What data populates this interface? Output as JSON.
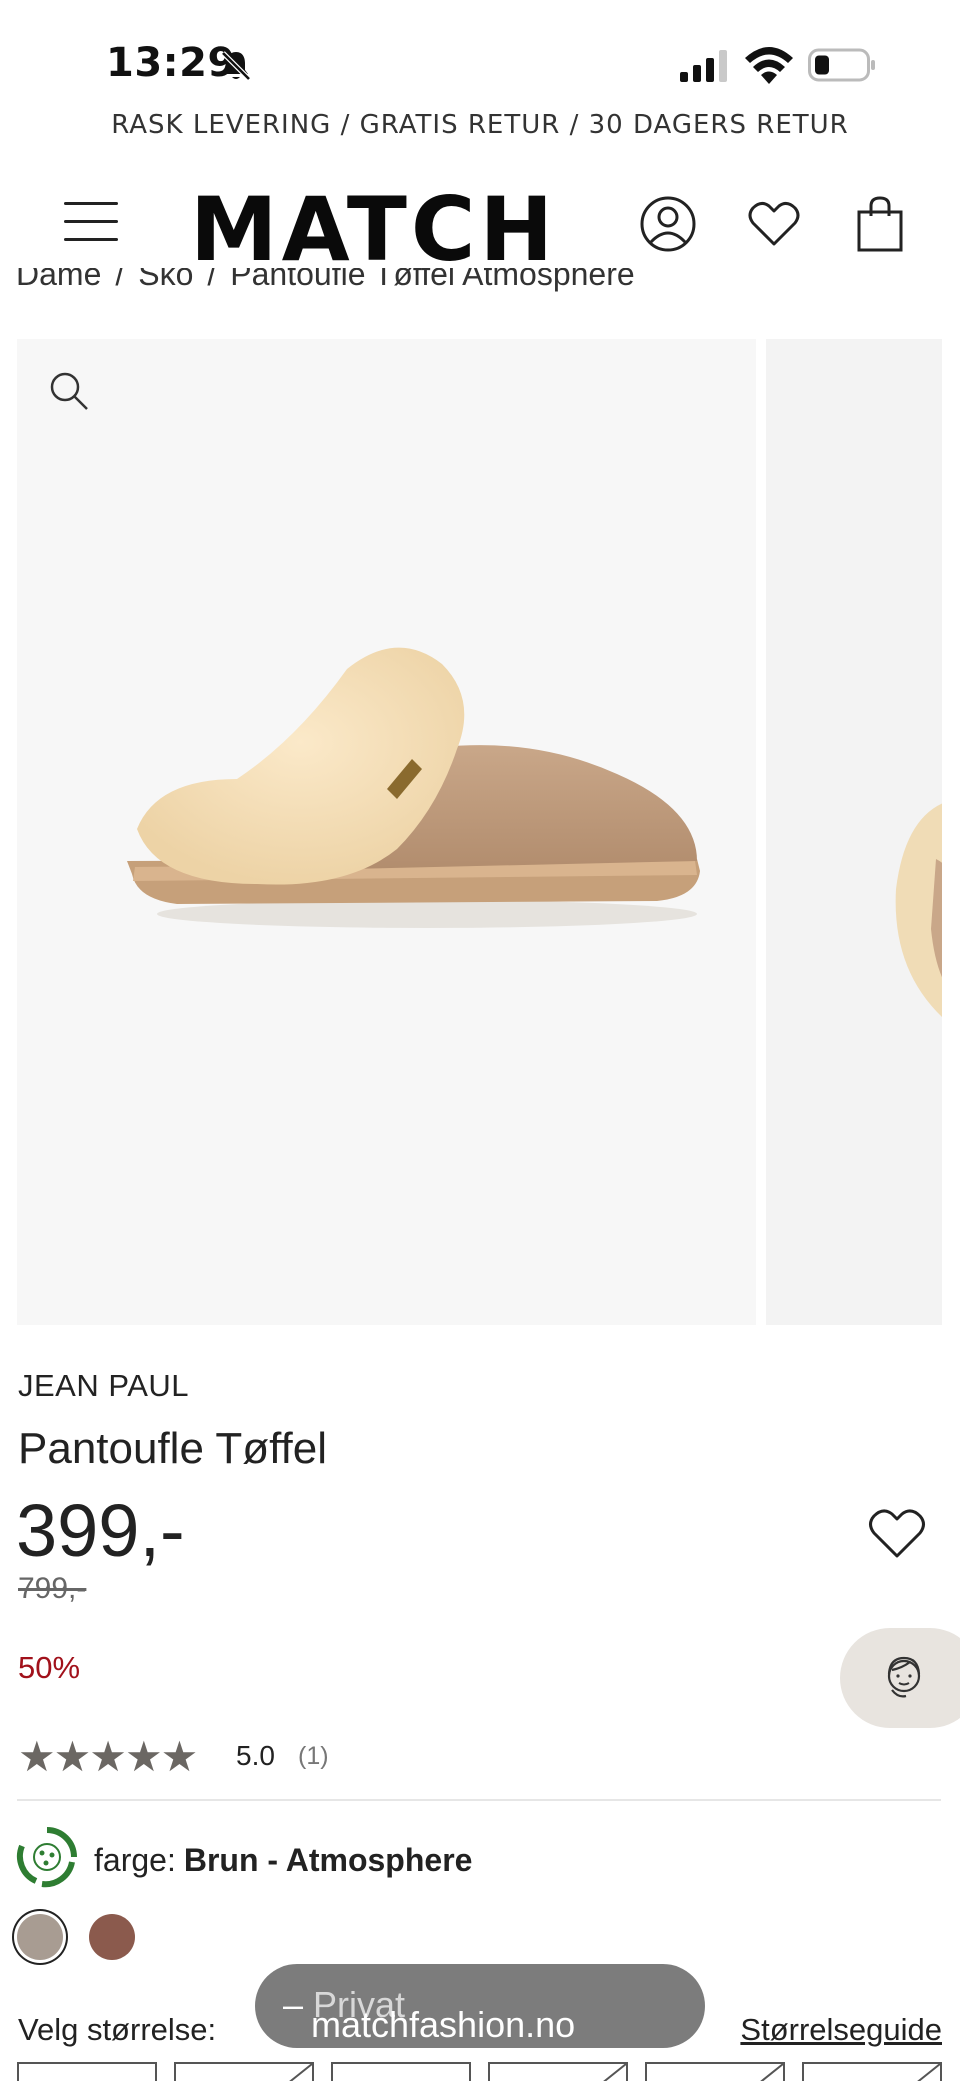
{
  "status_bar": {
    "time": "13:29"
  },
  "promo": {
    "text": "RASK LEVERING / GRATIS RETUR / 30 DAGERS RETUR"
  },
  "header": {
    "logo": "MATCH",
    "icons": [
      "menu-icon",
      "account-icon",
      "wishlist-icon",
      "bag-icon"
    ]
  },
  "breadcrumb": [
    "Dame",
    "Sko",
    "Pantoufle Tøffel Atmosphere"
  ],
  "product": {
    "brand": "JEAN PAUL",
    "title": "Pantoufle Tøffel",
    "price": "399,-",
    "old_price": "799,-",
    "discount": "50%",
    "rating": {
      "stars": "★★★★★",
      "value": "5.0",
      "count": "(1)",
      "score": 5
    },
    "color": {
      "label": "farge:",
      "value": "Brun - Atmosphere",
      "swatches": [
        "#a89c92",
        "#8b5a4d"
      ],
      "selected": 0
    },
    "size": {
      "label": "Velg størrelse:",
      "guide": "Størrelseguide"
    }
  },
  "browser": {
    "domain": "matchfashion.no",
    "mode": "Privat"
  }
}
